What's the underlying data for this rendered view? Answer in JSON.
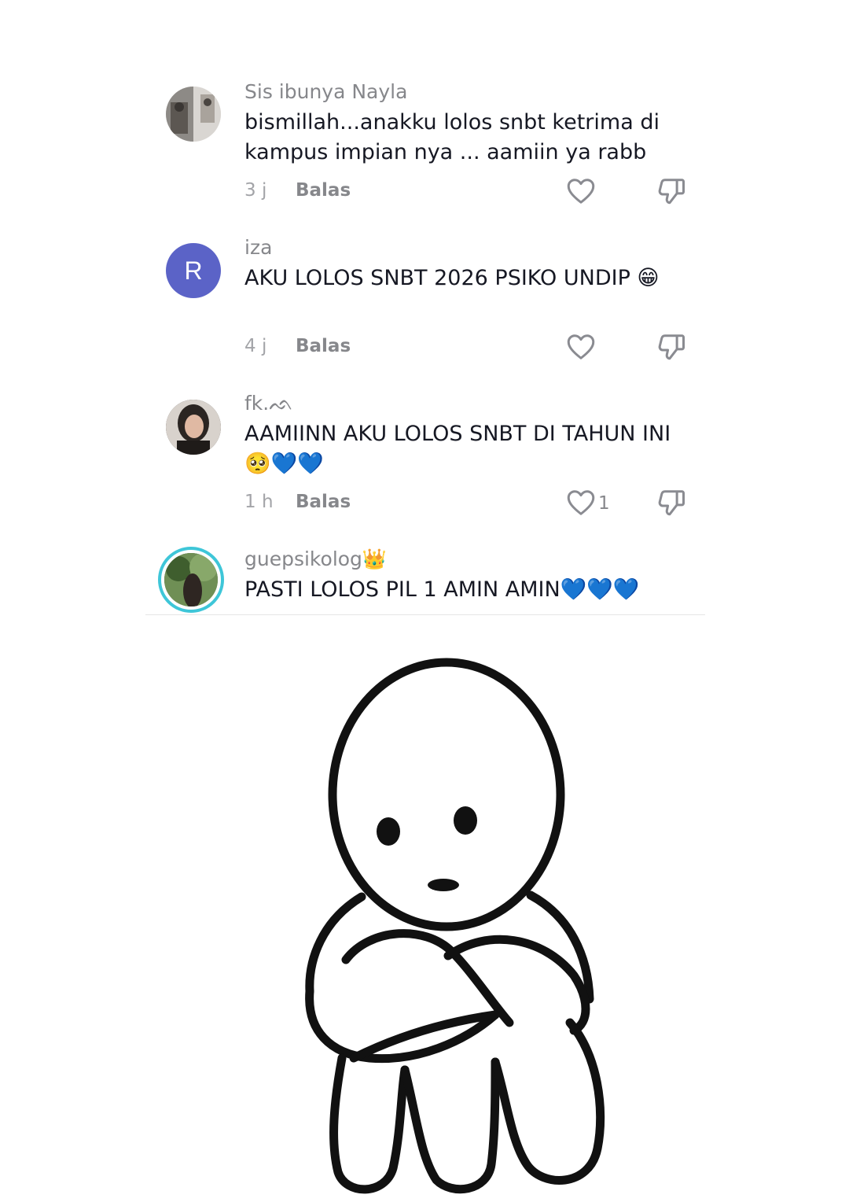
{
  "comments": [
    {
      "username": "Sis ibunya Nayla",
      "text": "bismillah...anakku lolos snbt ketrima di kampus impian nya ... aamiin ya rabb",
      "time": "3 j",
      "reply_label": "Balas",
      "likes": ""
    },
    {
      "username": "iza",
      "avatar_letter": "R",
      "avatar_color": "#5b63c7",
      "text": "AKU LOLOS SNBT 2026 PSIKO UNDIP 😁",
      "time": "4 j",
      "reply_label": "Balas",
      "likes": ""
    },
    {
      "username": "fk.ᨒ",
      "text": "AAMIINN AKU LOLOS SNBT DI TAHUN INI 🥺💙💙",
      "time": "1 h",
      "reply_label": "Balas",
      "likes": "1"
    },
    {
      "username": "guepsikolog👑",
      "text": "PASTI LOLOS PIL 1 AMIN AMIN💙💙💙",
      "story_ring_color": "#3ec6d8"
    }
  ],
  "icons": {
    "like": "heart-outline-icon",
    "dislike": "thumbs-down-icon"
  },
  "illustration": "sad-sitting-stick-figure"
}
